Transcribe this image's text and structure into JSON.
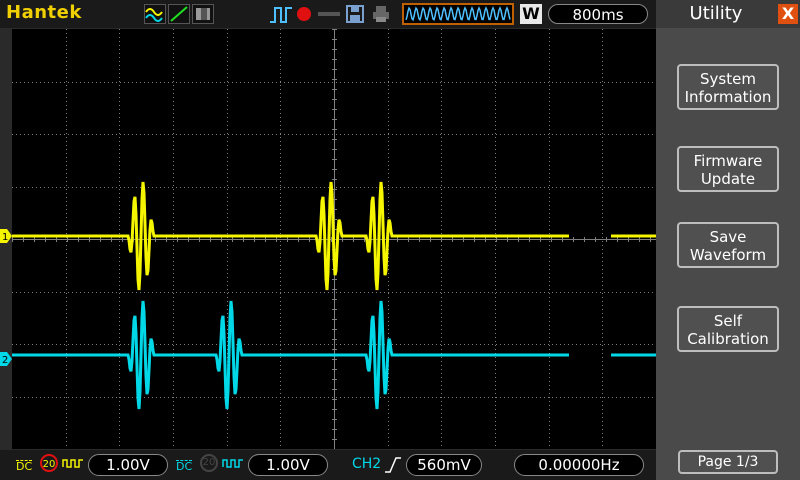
{
  "brand": "Hantek",
  "top": {
    "timebase": "800ms",
    "window_badge": "W"
  },
  "menu": {
    "title": "Utility",
    "close_label": "X",
    "buttons": [
      {
        "line1": "System",
        "line2": "Information"
      },
      {
        "line1": "Firmware",
        "line2": "Update"
      },
      {
        "line1": "Save",
        "line2": "Waveform"
      },
      {
        "line1": "Self",
        "line2": "Calibration"
      }
    ],
    "page": "Page 1/3"
  },
  "channels": {
    "ch1": {
      "label": "1",
      "color": "#f5f500",
      "coupling": "DC",
      "bw_limit": "20",
      "volts_div": "1.00V"
    },
    "ch2": {
      "label": "2",
      "color": "#00d8e8",
      "coupling": "DC",
      "bw_limit": "20",
      "volts_div": "1.00V"
    }
  },
  "trigger": {
    "source": "CH2",
    "slope": "rising",
    "level": "560mV",
    "frequency": "0.00000Hz"
  },
  "colors": {
    "ch1": "#f5f500",
    "ch2": "#00d8e8",
    "accent": "#e05010",
    "grid": "#808080"
  }
}
